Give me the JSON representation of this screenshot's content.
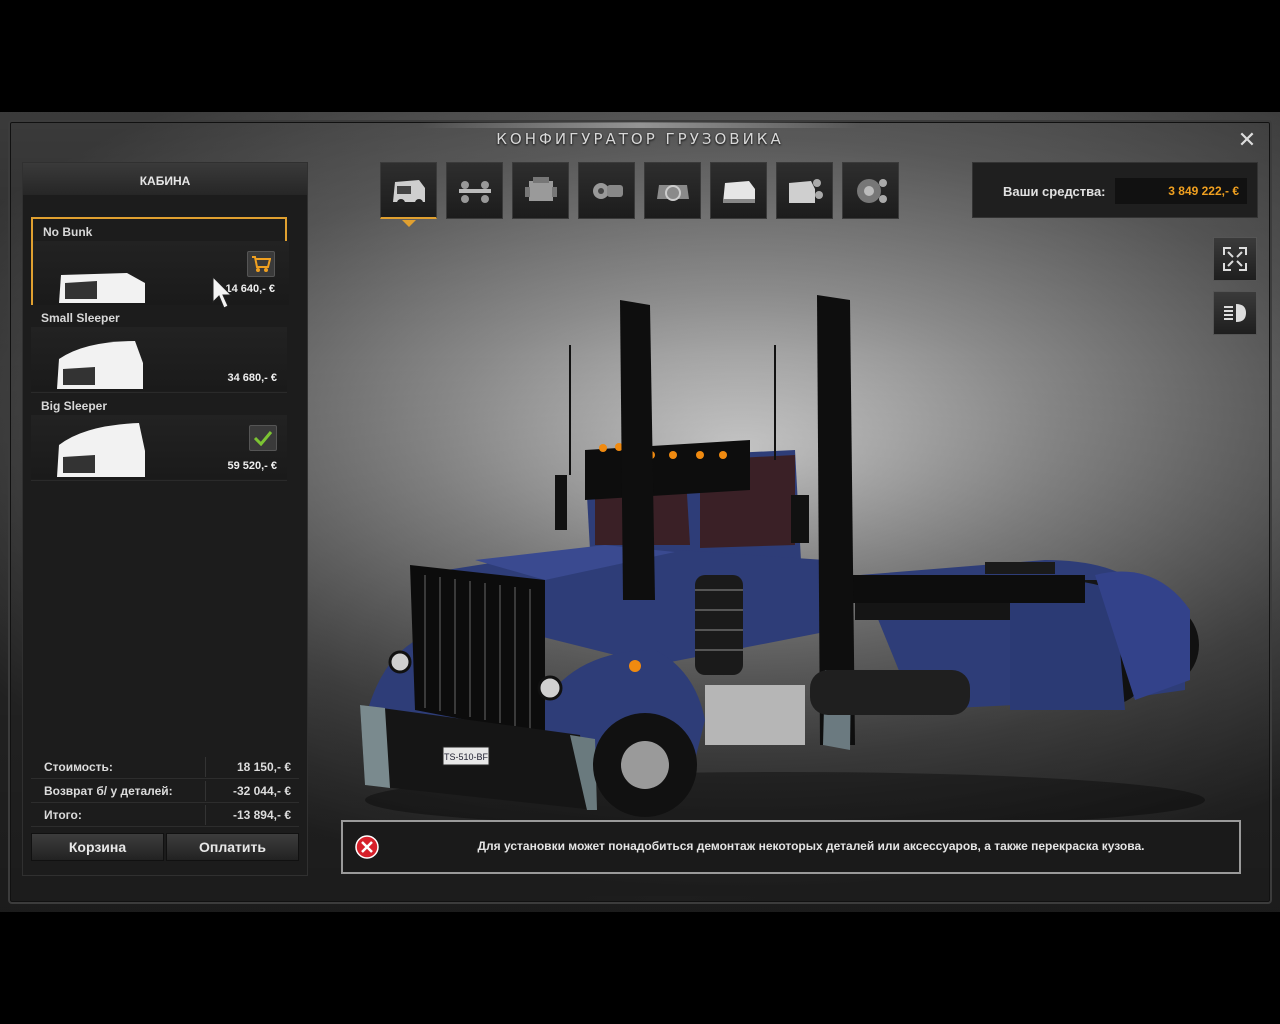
{
  "window": {
    "title": "КОНФИГУРАТОР ГРУЗОВИКА",
    "close_label": "✕"
  },
  "left_panel": {
    "header": "КАБИНА",
    "parts": [
      {
        "name": "No Bunk",
        "price": "14 640,- €",
        "status": "cart",
        "selected": true
      },
      {
        "name": "Small Sleeper",
        "price": "34 680,- €",
        "status": "none",
        "selected": false
      },
      {
        "name": "Big Sleeper",
        "price": "59 520,- €",
        "status": "installed",
        "selected": false
      }
    ],
    "summary": {
      "cost_label": "Стоимость:",
      "cost_value": "18 150,- €",
      "refund_label": "Возврат б/ у деталей:",
      "refund_value": "-32 044,- €",
      "total_label": "Итого:",
      "total_value": "-13 894,- €"
    },
    "buttons": {
      "cart": "Корзина",
      "pay": "Оплатить"
    }
  },
  "tabs": [
    {
      "icon": "cabin-icon",
      "active": true
    },
    {
      "icon": "chassis-icon",
      "active": false
    },
    {
      "icon": "engine-icon",
      "active": false
    },
    {
      "icon": "transmission-icon",
      "active": false
    },
    {
      "icon": "interior-icon",
      "active": false
    },
    {
      "icon": "paint-icon",
      "active": false
    },
    {
      "icon": "accessories-icon",
      "active": false
    },
    {
      "icon": "wheels-icon",
      "active": false
    }
  ],
  "funds": {
    "label": "Ваши средства:",
    "value": "3 849 222,- €"
  },
  "side_buttons": [
    "fullscreen-icon",
    "lights-icon"
  ],
  "notice": {
    "text": "Для установки может понадобиться демонтаж некоторых деталей или аксессуаров, а также перекраска кузова."
  },
  "truck": {
    "plate": "TS-510-BF",
    "color": "#2e3d78"
  },
  "colors": {
    "accent": "#e0a030",
    "funds": "#f0a020",
    "ok": "#7cc433",
    "error": "#d6202a"
  }
}
